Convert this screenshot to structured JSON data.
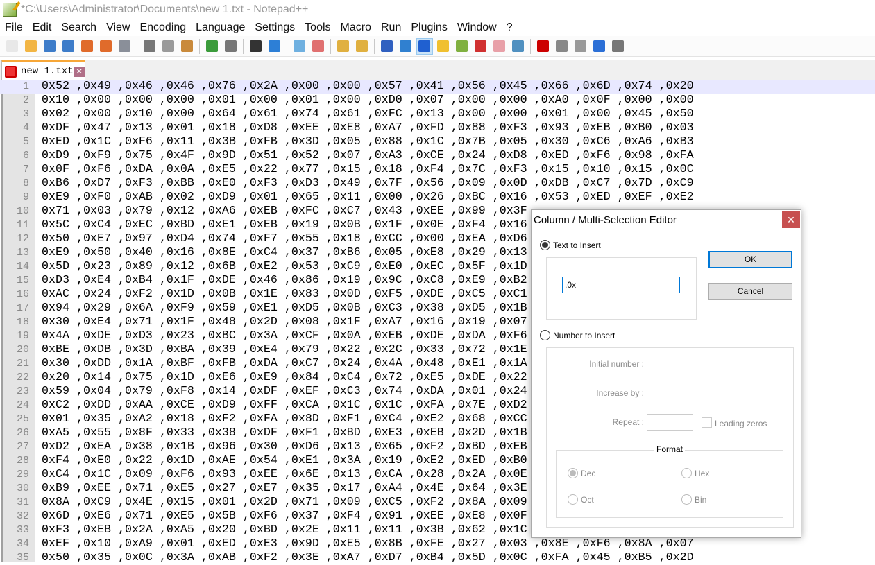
{
  "window": {
    "title": "*C:\\Users\\Administrator\\Documents\\new 1.txt - Notepad++"
  },
  "menu": [
    "File",
    "Edit",
    "Search",
    "View",
    "Encoding",
    "Language",
    "Settings",
    "Tools",
    "Macro",
    "Run",
    "Plugins",
    "Window",
    "?"
  ],
  "toolbar": [
    {
      "icon": "new-file-icon",
      "color": "#e8e8e8"
    },
    {
      "icon": "open-file-icon",
      "color": "#f2b544"
    },
    {
      "icon": "save-icon",
      "color": "#3d7cc9"
    },
    {
      "icon": "save-all-icon",
      "color": "#3d7cc9"
    },
    {
      "icon": "close-icon",
      "color": "#e06b2b"
    },
    {
      "icon": "close-all-icon",
      "color": "#e06b2b"
    },
    {
      "icon": "print-icon",
      "color": "#8a8f99"
    },
    {
      "sep": true
    },
    {
      "icon": "cut-icon",
      "color": "#777777"
    },
    {
      "icon": "copy-icon",
      "color": "#9a9a9a"
    },
    {
      "icon": "paste-icon",
      "color": "#c98a3c"
    },
    {
      "sep": true
    },
    {
      "icon": "undo-icon",
      "color": "#3b9b3b"
    },
    {
      "icon": "redo-icon",
      "color": "#777777"
    },
    {
      "sep": true
    },
    {
      "icon": "find-icon",
      "color": "#333333"
    },
    {
      "icon": "replace-icon",
      "color": "#2d7fd6"
    },
    {
      "sep": true
    },
    {
      "icon": "zoom-in-icon",
      "color": "#6fb0e0"
    },
    {
      "icon": "zoom-out-icon",
      "color": "#e07070"
    },
    {
      "sep": true
    },
    {
      "icon": "sync-vertical-icon",
      "color": "#e0b040"
    },
    {
      "icon": "sync-horizontal-icon",
      "color": "#e0b040"
    },
    {
      "sep": true
    },
    {
      "icon": "word-wrap-icon",
      "color": "#3060c0"
    },
    {
      "icon": "show-all-chars-icon",
      "color": "#3080d0"
    },
    {
      "icon": "indent-guide-icon",
      "color": "#2060d0",
      "active": true
    },
    {
      "icon": "udl-icon",
      "color": "#f0c030"
    },
    {
      "icon": "doc-map-icon",
      "color": "#80b040"
    },
    {
      "icon": "function-list-icon",
      "color": "#d03030"
    },
    {
      "icon": "folder-workspace-icon",
      "color": "#e8a0a8"
    },
    {
      "icon": "monitoring-icon",
      "color": "#5090c0"
    },
    {
      "sep": true
    },
    {
      "icon": "record-macro-icon",
      "color": "#cc0000"
    },
    {
      "icon": "stop-macro-icon",
      "color": "#888888"
    },
    {
      "icon": "play-macro-icon",
      "color": "#999999"
    },
    {
      "icon": "run-macro-multiple-icon",
      "color": "#2b6fd6"
    },
    {
      "icon": "save-macro-icon",
      "color": "#777777"
    }
  ],
  "tabs": [
    {
      "label": "new 1.txt",
      "close": "✕"
    }
  ],
  "editor": {
    "lines": [
      [
        "0x52",
        "0x49",
        "0x46",
        "0x46",
        "0x76",
        "0x2A",
        "0x00",
        "0x00",
        "0x57",
        "0x41",
        "0x56",
        "0x45",
        "0x66",
        "0x6D",
        "0x74",
        "0x20"
      ],
      [
        "0x10",
        "0x00",
        "0x00",
        "0x00",
        "0x01",
        "0x00",
        "0x01",
        "0x00",
        "0xD0",
        "0x07",
        "0x00",
        "0x00",
        "0xA0",
        "0x0F",
        "0x00",
        "0x00"
      ],
      [
        "0x02",
        "0x00",
        "0x10",
        "0x00",
        "0x64",
        "0x61",
        "0x74",
        "0x61",
        "0xFC",
        "0x13",
        "0x00",
        "0x00",
        "0x01",
        "0x00",
        "0x45",
        "0x50"
      ],
      [
        "0xDF",
        "0x47",
        "0x13",
        "0x01",
        "0x18",
        "0xD8",
        "0xEE",
        "0xE8",
        "0xA7",
        "0xFD",
        "0x88",
        "0xF3",
        "0x93",
        "0xEB",
        "0xB0",
        "0x03"
      ],
      [
        "0xED",
        "0x1C",
        "0xF6",
        "0x11",
        "0x3B",
        "0xFB",
        "0x3D",
        "0x05",
        "0x88",
        "0x1C",
        "0x7B",
        "0x05",
        "0x30",
        "0xC6",
        "0xA6",
        "0xB3"
      ],
      [
        "0xD9",
        "0xF9",
        "0x75",
        "0x4F",
        "0x9D",
        "0x51",
        "0x52",
        "0x07",
        "0xA3",
        "0xCE",
        "0x24",
        "0xD8",
        "0xED",
        "0xF6",
        "0x98",
        "0xFA"
      ],
      [
        "0x0F",
        "0xF6",
        "0xDA",
        "0x0A",
        "0xE5",
        "0x22",
        "0x77",
        "0x15",
        "0x18",
        "0xF4",
        "0x7C",
        "0xF3",
        "0x15",
        "0x10",
        "0x15",
        "0x0C"
      ],
      [
        "0xB6",
        "0xD7",
        "0xF3",
        "0xBB",
        "0xE0",
        "0xF3",
        "0xD3",
        "0x49",
        "0x7F",
        "0x56",
        "0x09",
        "0x0D",
        "0xDB",
        "0xC7",
        "0x7D",
        "0xC9"
      ],
      [
        "0xE9",
        "0xF0",
        "0xAB",
        "0x02",
        "0xD9",
        "0x01",
        "0x65",
        "0x11",
        "0x00",
        "0x26",
        "0xBC",
        "0x16",
        "0x53",
        "0xED",
        "0xEF",
        "0xE2"
      ],
      [
        "0x71",
        "0x03",
        "0x79",
        "0x12",
        "0xA6",
        "0xEB",
        "0xFC",
        "0xC7",
        "0x43",
        "0xEE",
        "0x99",
        "0x3F"
      ],
      [
        "0x5C",
        "0xC4",
        "0xEC",
        "0xBD",
        "0xE1",
        "0xEB",
        "0x19",
        "0x0B",
        "0x1F",
        "0x0E",
        "0xF4",
        "0x16"
      ],
      [
        "0x50",
        "0xE7",
        "0x97",
        "0xD4",
        "0x74",
        "0xF7",
        "0x55",
        "0x18",
        "0xCC",
        "0x00",
        "0xEA",
        "0xD6"
      ],
      [
        "0xE9",
        "0x50",
        "0x40",
        "0x16",
        "0x8E",
        "0xC4",
        "0x37",
        "0xB6",
        "0x05",
        "0xE8",
        "0x29",
        "0x13"
      ],
      [
        "0x5D",
        "0x23",
        "0x89",
        "0x12",
        "0x6B",
        "0xE2",
        "0x53",
        "0xC9",
        "0xE0",
        "0xEC",
        "0x5F",
        "0x1D"
      ],
      [
        "0xD3",
        "0xE4",
        "0xB4",
        "0x1F",
        "0xDE",
        "0x46",
        "0x86",
        "0x19",
        "0x9C",
        "0xC8",
        "0xE9",
        "0xB2"
      ],
      [
        "0xAC",
        "0x24",
        "0xF2",
        "0x1D",
        "0x0B",
        "0x1E",
        "0x83",
        "0x0D",
        "0xF5",
        "0xDE",
        "0xC5",
        "0xC1"
      ],
      [
        "0x94",
        "0x29",
        "0x6A",
        "0xF9",
        "0x59",
        "0xE1",
        "0xD5",
        "0x0B",
        "0xC3",
        "0x38",
        "0xD5",
        "0x1B"
      ],
      [
        "0x30",
        "0xE4",
        "0x71",
        "0x1F",
        "0x48",
        "0x2D",
        "0x08",
        "0x1F",
        "0xA7",
        "0x16",
        "0x19",
        "0x07"
      ],
      [
        "0x4A",
        "0xDE",
        "0xD3",
        "0x23",
        "0xBC",
        "0x3A",
        "0xCF",
        "0x0A",
        "0xEB",
        "0xDE",
        "0xDA",
        "0xF6"
      ],
      [
        "0xBE",
        "0xDB",
        "0x3D",
        "0xBA",
        "0x39",
        "0xE4",
        "0x79",
        "0x22",
        "0x2C",
        "0x33",
        "0x72",
        "0x1E"
      ],
      [
        "0x30",
        "0xDD",
        "0x1A",
        "0xBF",
        "0xFB",
        "0xDA",
        "0xC7",
        "0x24",
        "0x4A",
        "0x48",
        "0xE1",
        "0x1A"
      ],
      [
        "0x20",
        "0x14",
        "0x75",
        "0x1D",
        "0xE6",
        "0xE9",
        "0x84",
        "0xC4",
        "0x72",
        "0xE5",
        "0xDE",
        "0x22"
      ],
      [
        "0x59",
        "0x04",
        "0x79",
        "0xF8",
        "0x14",
        "0xDF",
        "0xEF",
        "0xC3",
        "0x74",
        "0xDA",
        "0x01",
        "0x24"
      ],
      [
        "0xC2",
        "0xDD",
        "0xAA",
        "0xCE",
        "0xD9",
        "0xFF",
        "0xCA",
        "0x1C",
        "0x1C",
        "0xFA",
        "0x7E",
        "0xD2"
      ],
      [
        "0x01",
        "0x35",
        "0xA2",
        "0x18",
        "0xF2",
        "0xFA",
        "0x8D",
        "0xF1",
        "0xC4",
        "0xE2",
        "0x68",
        "0xCC"
      ],
      [
        "0xA5",
        "0x55",
        "0x8F",
        "0x33",
        "0x38",
        "0xDF",
        "0xF1",
        "0xBD",
        "0xE3",
        "0xEB",
        "0x2D",
        "0x1B"
      ],
      [
        "0xD2",
        "0xEA",
        "0x38",
        "0x1B",
        "0x96",
        "0x30",
        "0xD6",
        "0x13",
        "0x65",
        "0xF2",
        "0xBD",
        "0xEB"
      ],
      [
        "0xF4",
        "0xE0",
        "0x22",
        "0x1D",
        "0xAE",
        "0x54",
        "0xE1",
        "0x3A",
        "0x19",
        "0xE2",
        "0xED",
        "0xB0"
      ],
      [
        "0xC4",
        "0x1C",
        "0x09",
        "0xF6",
        "0x93",
        "0xEE",
        "0x6E",
        "0x13",
        "0xCA",
        "0x28",
        "0x2A",
        "0x0E"
      ],
      [
        "0xB9",
        "0xEE",
        "0x71",
        "0xE5",
        "0x27",
        "0xE7",
        "0x35",
        "0x17",
        "0xA4",
        "0x4E",
        "0x64",
        "0x3E"
      ],
      [
        "0x8A",
        "0xC9",
        "0x4E",
        "0x15",
        "0x01",
        "0x2D",
        "0x71",
        "0x09",
        "0xC5",
        "0xF2",
        "0x8A",
        "0x09"
      ],
      [
        "0x6D",
        "0xE6",
        "0x71",
        "0xE5",
        "0x5B",
        "0xF6",
        "0x37",
        "0xF4",
        "0x91",
        "0xEE",
        "0xE8",
        "0x0F"
      ],
      [
        "0xF3",
        "0xEB",
        "0x2A",
        "0xA5",
        "0x20",
        "0xBD",
        "0x2E",
        "0x11",
        "0x11",
        "0x3B",
        "0x62",
        "0x1C"
      ],
      [
        "0xEF",
        "0x10",
        "0xA9",
        "0x01",
        "0xED",
        "0xE3",
        "0x9D",
        "0xE5",
        "0x8B",
        "0xFE",
        "0x27",
        "0x03",
        "0x8E",
        "0xF6",
        "0x8A",
        "0x07"
      ],
      [
        "0x50",
        "0x35",
        "0x0C",
        "0x3A",
        "0xAB",
        "0xF2",
        "0x3E",
        "0xA7",
        "0xD7",
        "0xB4",
        "0x5D",
        "0x0C",
        "0xFA",
        "0x45",
        "0xB5",
        "0x2D"
      ]
    ]
  },
  "dialog": {
    "title": "Column / Multi-Selection Editor",
    "close": "✕",
    "text_option": "Text to Insert",
    "text_value": ",0x",
    "number_option": "Number to Insert",
    "initial_label": "Initial number :",
    "increase_label": "Increase by :",
    "repeat_label": "Repeat :",
    "leading_zeros": "Leading zeros",
    "format_label": "Format",
    "formats": [
      "Dec",
      "Hex",
      "Oct",
      "Bin"
    ],
    "selected_format": "Dec",
    "ok": "OK",
    "cancel": "Cancel"
  }
}
